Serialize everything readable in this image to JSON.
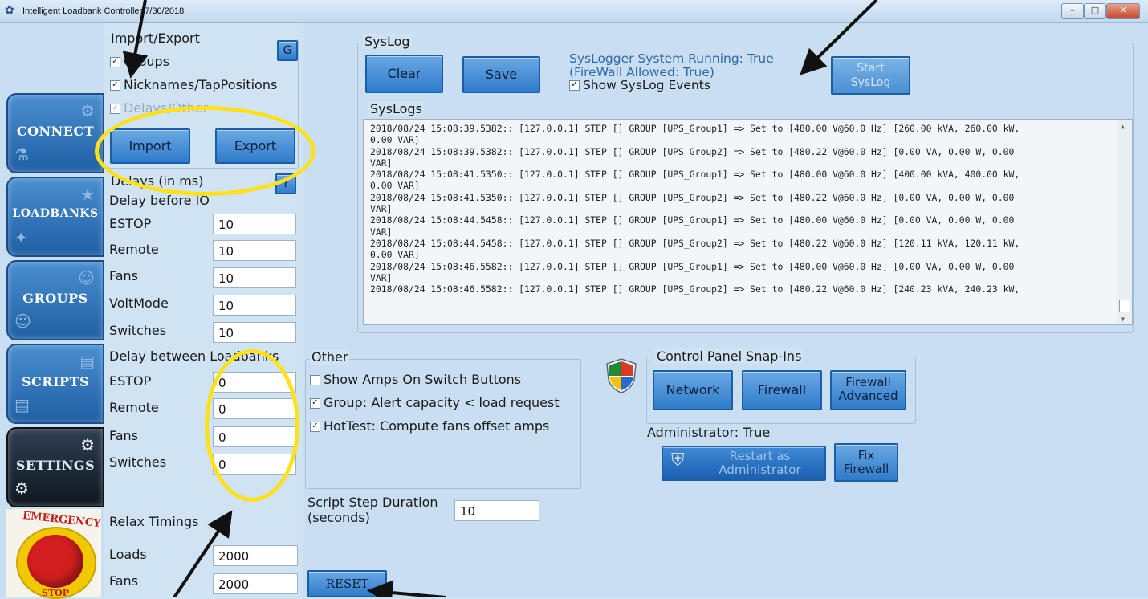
{
  "window": {
    "title": "Intelligent Loadbank Controller  7/30/2018",
    "minimize": "–",
    "maximize": "□",
    "close": "✕"
  },
  "nav": [
    {
      "label": "CONNECT"
    },
    {
      "label": "LOADBANKS"
    },
    {
      "label": "GROUPS"
    },
    {
      "label": "SCRIPTS"
    },
    {
      "label": "SETTINGS"
    }
  ],
  "estop": {
    "top": "EMERGENCY",
    "bottom": "STOP"
  },
  "import_export": {
    "title": "Import/Export",
    "g_button": "G",
    "options": [
      {
        "label": "Groups",
        "checked": true
      },
      {
        "label": "Nicknames/TapPositions",
        "checked": true
      },
      {
        "label": "Delays/Other",
        "checked": true,
        "disabled": true
      }
    ],
    "import_label": "Import",
    "export_label": "Export"
  },
  "delays": {
    "title": "Delays (in ms)",
    "help": "?",
    "before_io": "Delay before IO",
    "before_rows": [
      {
        "label": "ESTOP",
        "value": "10"
      },
      {
        "label": "Remote",
        "value": "10"
      },
      {
        "label": "Fans",
        "value": "10"
      },
      {
        "label": "VoltMode",
        "value": "10"
      },
      {
        "label": "Switches",
        "value": "10"
      }
    ],
    "between": "Delay between Loadbanks",
    "between_rows": [
      {
        "label": "ESTOP",
        "value": "0"
      },
      {
        "label": "Remote",
        "value": "0"
      },
      {
        "label": "Fans",
        "value": "0"
      },
      {
        "label": "Switches",
        "value": "0"
      }
    ],
    "relax": "Relax Timings",
    "relax_rows": [
      {
        "label": "Loads",
        "value": "2000"
      },
      {
        "label": "Fans",
        "value": "2000"
      }
    ]
  },
  "syslog": {
    "title": "SysLog",
    "clear": "Clear",
    "save": "Save",
    "status1": "SysLogger System Running: True",
    "status2": "(FireWall Allowed: True)",
    "show_events": "Show SysLog Events",
    "start_label": "Start SysLog",
    "logs_title": "SysLogs",
    "lines": [
      "2018/08/24 15:08:39.5382::  [127.0.0.1]  STEP [] GROUP [UPS_Group1] => Set to [480.00 V@60.0 Hz] [260.00 kVA, 260.00 kW,",
      "0.00 VAR]",
      "2018/08/24 15:08:39.5382::  [127.0.0.1]  STEP [] GROUP [UPS_Group2] => Set to [480.22 V@60.0 Hz] [0.00 VA, 0.00 W, 0.00",
      "VAR]",
      "2018/08/24 15:08:41.5350::  [127.0.0.1]  STEP [] GROUP [UPS_Group1] => Set to [480.00 V@60.0 Hz] [400.00 kVA, 400.00 kW,",
      "0.00 VAR]",
      "2018/08/24 15:08:41.5350::  [127.0.0.1]  STEP [] GROUP [UPS_Group2] => Set to [480.22 V@60.0 Hz] [0.00 VA, 0.00 W, 0.00",
      "VAR]",
      "2018/08/24 15:08:44.5458::  [127.0.0.1]  STEP [] GROUP [UPS_Group1] => Set to [480.00 V@60.0 Hz] [0.00 VA, 0.00 W, 0.00",
      "VAR]",
      "2018/08/24 15:08:44.5458::  [127.0.0.1]  STEP [] GROUP [UPS_Group2] => Set to [480.22 V@60.0 Hz] [120.11 kVA, 120.11 kW,",
      "0.00 VAR]",
      "2018/08/24 15:08:46.5582::  [127.0.0.1]  STEP [] GROUP [UPS_Group1] => Set to [480.00 V@60.0 Hz] [0.00 VA, 0.00 W, 0.00",
      "VAR]",
      "2018/08/24 15:08:46.5582::  [127.0.0.1]  STEP [] GROUP [UPS_Group2] => Set to [480.22 V@60.0 Hz] [240.23 kVA, 240.23 kW,"
    ]
  },
  "other": {
    "title": "Other",
    "options": [
      {
        "label": "Show Amps On Switch Buttons",
        "checked": false
      },
      {
        "label": "Group: Alert capacity < load request",
        "checked": true
      },
      {
        "label": "HotTest: Compute fans offset amps",
        "checked": true
      }
    ],
    "script_step_label1": "Script Step Duration",
    "script_step_label2": "(seconds)",
    "script_step_value": "10",
    "reset": "RESET"
  },
  "snapins": {
    "title": "Control Panel Snap-Ins",
    "network": "Network",
    "firewall": "Firewall",
    "firewall_adv1": "Firewall",
    "firewall_adv2": "Advanced",
    "admin_status": "Administrator: True",
    "restart_admin1": "Restart as",
    "restart_admin2": "Administrator",
    "fix_fw1": "Fix",
    "fix_fw2": "Firewall"
  },
  "colors": {
    "accent": "#2f7ccb",
    "annotation": "#ffe11a",
    "arrow": "#111111"
  }
}
